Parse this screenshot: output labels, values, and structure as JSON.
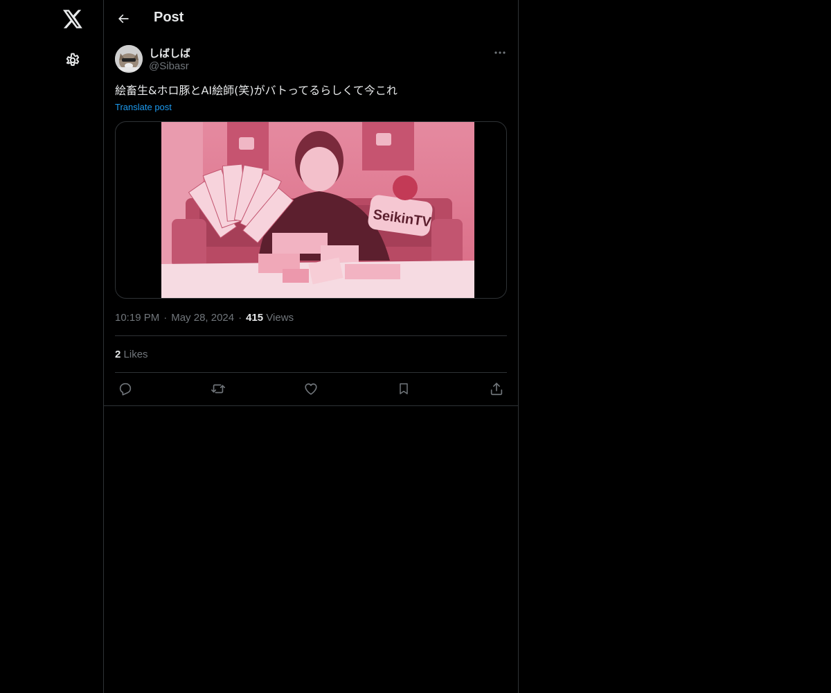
{
  "nav": {
    "logo_icon": "x-logo-icon",
    "settings_icon": "gear-icon"
  },
  "header": {
    "back_icon": "arrow-left-icon",
    "title": "Post"
  },
  "post": {
    "author": {
      "name": "しばしば",
      "handle": "@Sibasr"
    },
    "text": "絵畜生&ホロ豚とAI絵師(笑)がバトってるらしくて今これ",
    "translate_label": "Translate post",
    "media": {
      "overlay_text": "SeikinTV"
    },
    "time": "10:19 PM",
    "date": "May 28, 2024",
    "views_count": "415",
    "views_label": "Views",
    "likes_count": "2",
    "likes_label": "Likes"
  },
  "actions": [
    {
      "name": "reply",
      "icon": "reply-icon"
    },
    {
      "name": "repost",
      "icon": "repost-icon"
    },
    {
      "name": "like",
      "icon": "heart-icon"
    },
    {
      "name": "bookmark",
      "icon": "bookmark-icon"
    },
    {
      "name": "share",
      "icon": "share-icon"
    }
  ],
  "colors": {
    "background": "#000000",
    "text_primary": "#e7e9ea",
    "text_secondary": "#71767b",
    "link": "#1d9bf0",
    "border": "#2f3336",
    "media_tint": "#e8637f"
  }
}
